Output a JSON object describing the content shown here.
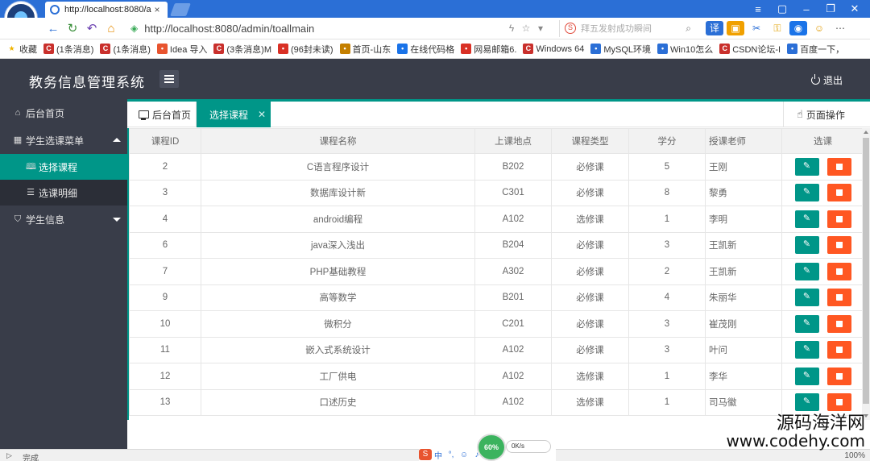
{
  "browser": {
    "tab_title": "http://localhost:8080/a",
    "url": "http://localhost:8080/admin/toallmain",
    "search_placeholder": "拜五发射成功瞬间",
    "status_text": "完成",
    "zoom": "100%",
    "bookmarks": [
      {
        "label": "收藏",
        "icon": "star-icon",
        "color": "#f0b400"
      },
      {
        "label": "(1条消息)",
        "icon": "csdn-icon",
        "color": "#c9302c"
      },
      {
        "label": "(1条消息)",
        "icon": "csdn-icon",
        "color": "#c9302c"
      },
      {
        "label": "Idea 导入",
        "icon": "idea-icon",
        "color": "#e8542f"
      },
      {
        "label": "(3条消息)M",
        "icon": "csdn-icon",
        "color": "#c9302c"
      },
      {
        "label": "(96封未读)",
        "icon": "qq-icon",
        "color": "#d93025"
      },
      {
        "label": "首页-山东",
        "icon": "site-icon",
        "color": "#c47f00"
      },
      {
        "label": "在线代码格",
        "icon": "ie-icon",
        "color": "#1a73e8"
      },
      {
        "label": "网易邮箱6.",
        "icon": "mail-icon",
        "color": "#d93025"
      },
      {
        "label": "Windows 64",
        "icon": "csdn-icon",
        "color": "#c9302c"
      },
      {
        "label": "MySQL环境",
        "icon": "paw-icon",
        "color": "#2b6fd6"
      },
      {
        "label": "Win10怎么",
        "icon": "paw-icon",
        "color": "#2b6fd6"
      },
      {
        "label": "CSDN论坛-I",
        "icon": "csdn-icon",
        "color": "#c9302c"
      },
      {
        "label": "百度一下，",
        "icon": "paw-icon",
        "color": "#2b6fd6"
      }
    ]
  },
  "app": {
    "title": "教务信息管理系统",
    "logout_label": "退出",
    "accent": "#009688",
    "danger": "#ff5722",
    "header_bg": "#393d49"
  },
  "sidebar": {
    "home": "后台首页",
    "menu_course": "学生选课菜单",
    "sub_select": "选择课程",
    "sub_detail": "选课明细",
    "menu_student": "学生信息"
  },
  "content_tabs": {
    "home": "后台首页",
    "current": "选择课程",
    "page_ops": "页面操作"
  },
  "table": {
    "headers": [
      "课程ID",
      "课程名称",
      "上课地点",
      "课程类型",
      "学分",
      "授课老师",
      "选课"
    ],
    "rows": [
      [
        "2",
        "C语言程序设计",
        "B202",
        "必修课",
        "5",
        "王刚"
      ],
      [
        "3",
        "数据库设计新",
        "C301",
        "必修课",
        "8",
        "黎勇"
      ],
      [
        "4",
        "android编程",
        "A102",
        "选修课",
        "1",
        "李明"
      ],
      [
        "6",
        "java深入浅出",
        "B204",
        "必修课",
        "3",
        "王凯新"
      ],
      [
        "7",
        "PHP基础教程",
        "A302",
        "必修课",
        "2",
        "王凯新"
      ],
      [
        "9",
        "高等数学",
        "B201",
        "必修课",
        "4",
        "朱丽华"
      ],
      [
        "10",
        "微积分",
        "C201",
        "必修课",
        "3",
        "崔茂刚"
      ],
      [
        "11",
        "嵌入式系统设计",
        "A102",
        "必修课",
        "3",
        "叶问"
      ],
      [
        "12",
        "工厂供电",
        "A102",
        "选修课",
        "1",
        "李华"
      ],
      [
        "13",
        "口述历史",
        "A102",
        "选修课",
        "1",
        "司马徽"
      ]
    ]
  },
  "overlay": {
    "net_percent": "60%",
    "net_speed": "0K/s",
    "watermark_cn": "源码海洋网",
    "watermark_url": "www.codehy.com"
  }
}
